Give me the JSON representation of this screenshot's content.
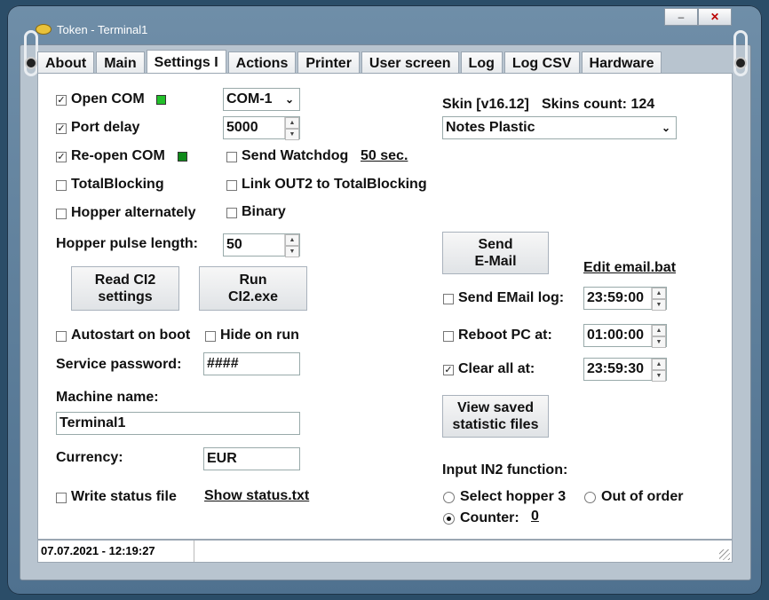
{
  "window": {
    "title": "Token - Terminal1",
    "minimize_label": "–",
    "close_label": "✕"
  },
  "tabs": [
    {
      "label": "About"
    },
    {
      "label": "Main"
    },
    {
      "label": "Settings I",
      "active": true
    },
    {
      "label": "Actions"
    },
    {
      "label": "Printer"
    },
    {
      "label": "User screen"
    },
    {
      "label": "Log"
    },
    {
      "label": "Log CSV"
    },
    {
      "label": "Hardware"
    }
  ],
  "left": {
    "open_com": {
      "label": "Open COM",
      "checked": true,
      "led_color": "#22c02a"
    },
    "com_port": {
      "value": "COM-1"
    },
    "port_delay": {
      "label": "Port delay",
      "checked": true,
      "value": "5000"
    },
    "reopen_com": {
      "label": "Re-open COM",
      "checked": true,
      "led_color": "#0f8a1a"
    },
    "send_watchdog": {
      "label": "Send Watchdog",
      "checked": false,
      "link": "50 sec."
    },
    "total_blocking": {
      "label": "TotalBlocking",
      "checked": false
    },
    "link_out2": {
      "label": "Link OUT2 to TotalBlocking",
      "checked": false
    },
    "hopper_alternately": {
      "label": "Hopper alternately",
      "checked": false
    },
    "binary": {
      "label": "Binary",
      "checked": false
    },
    "hopper_pulse": {
      "label": "Hopper pulse length:",
      "value": "50"
    },
    "read_ci2": {
      "label": "Read CI2 settings"
    },
    "run_ci2": {
      "label": "Run CI2.exe"
    },
    "autostart": {
      "label": "Autostart on boot",
      "checked": false
    },
    "hide_on_run": {
      "label": "Hide on run",
      "checked": false
    },
    "service_password": {
      "label": "Service password:",
      "value": "####"
    },
    "machine_name": {
      "label": "Machine name:",
      "value": "Terminal1"
    },
    "currency": {
      "label": "Currency:",
      "value": "EUR"
    },
    "write_status": {
      "label": "Write status file",
      "checked": false,
      "link": "Show status.txt"
    }
  },
  "right": {
    "skin_version": "Skin [v16.12]",
    "skins_count": "Skins count: 124",
    "skin_select": "Notes Plastic",
    "send_email_button": "Send E-Mail",
    "edit_email_link": "Edit email.bat",
    "send_email_log": {
      "label": "Send EMail log:",
      "checked": false,
      "time": "23:59:00"
    },
    "reboot_pc": {
      "label": "Reboot PC at:",
      "checked": false,
      "time": "01:00:00"
    },
    "clear_all": {
      "label": "Clear all at:",
      "checked": true,
      "time": "23:59:30"
    },
    "view_saved_button": "View saved statistic files",
    "input_in2_label": "Input IN2 function:",
    "select_hopper3": {
      "label": "Select hopper 3",
      "selected": false
    },
    "out_of_order": {
      "label": "Out of order",
      "selected": false
    },
    "counter": {
      "label": "Counter:",
      "selected": true,
      "value": "0"
    }
  },
  "status": {
    "datetime": "07.07.2021 - 12:19:27"
  },
  "icons": {
    "app": "token-coin-icon",
    "dropdown": "chevron-down-icon",
    "spin": "spin-arrows-icon",
    "resize": "resize-grip-icon"
  }
}
